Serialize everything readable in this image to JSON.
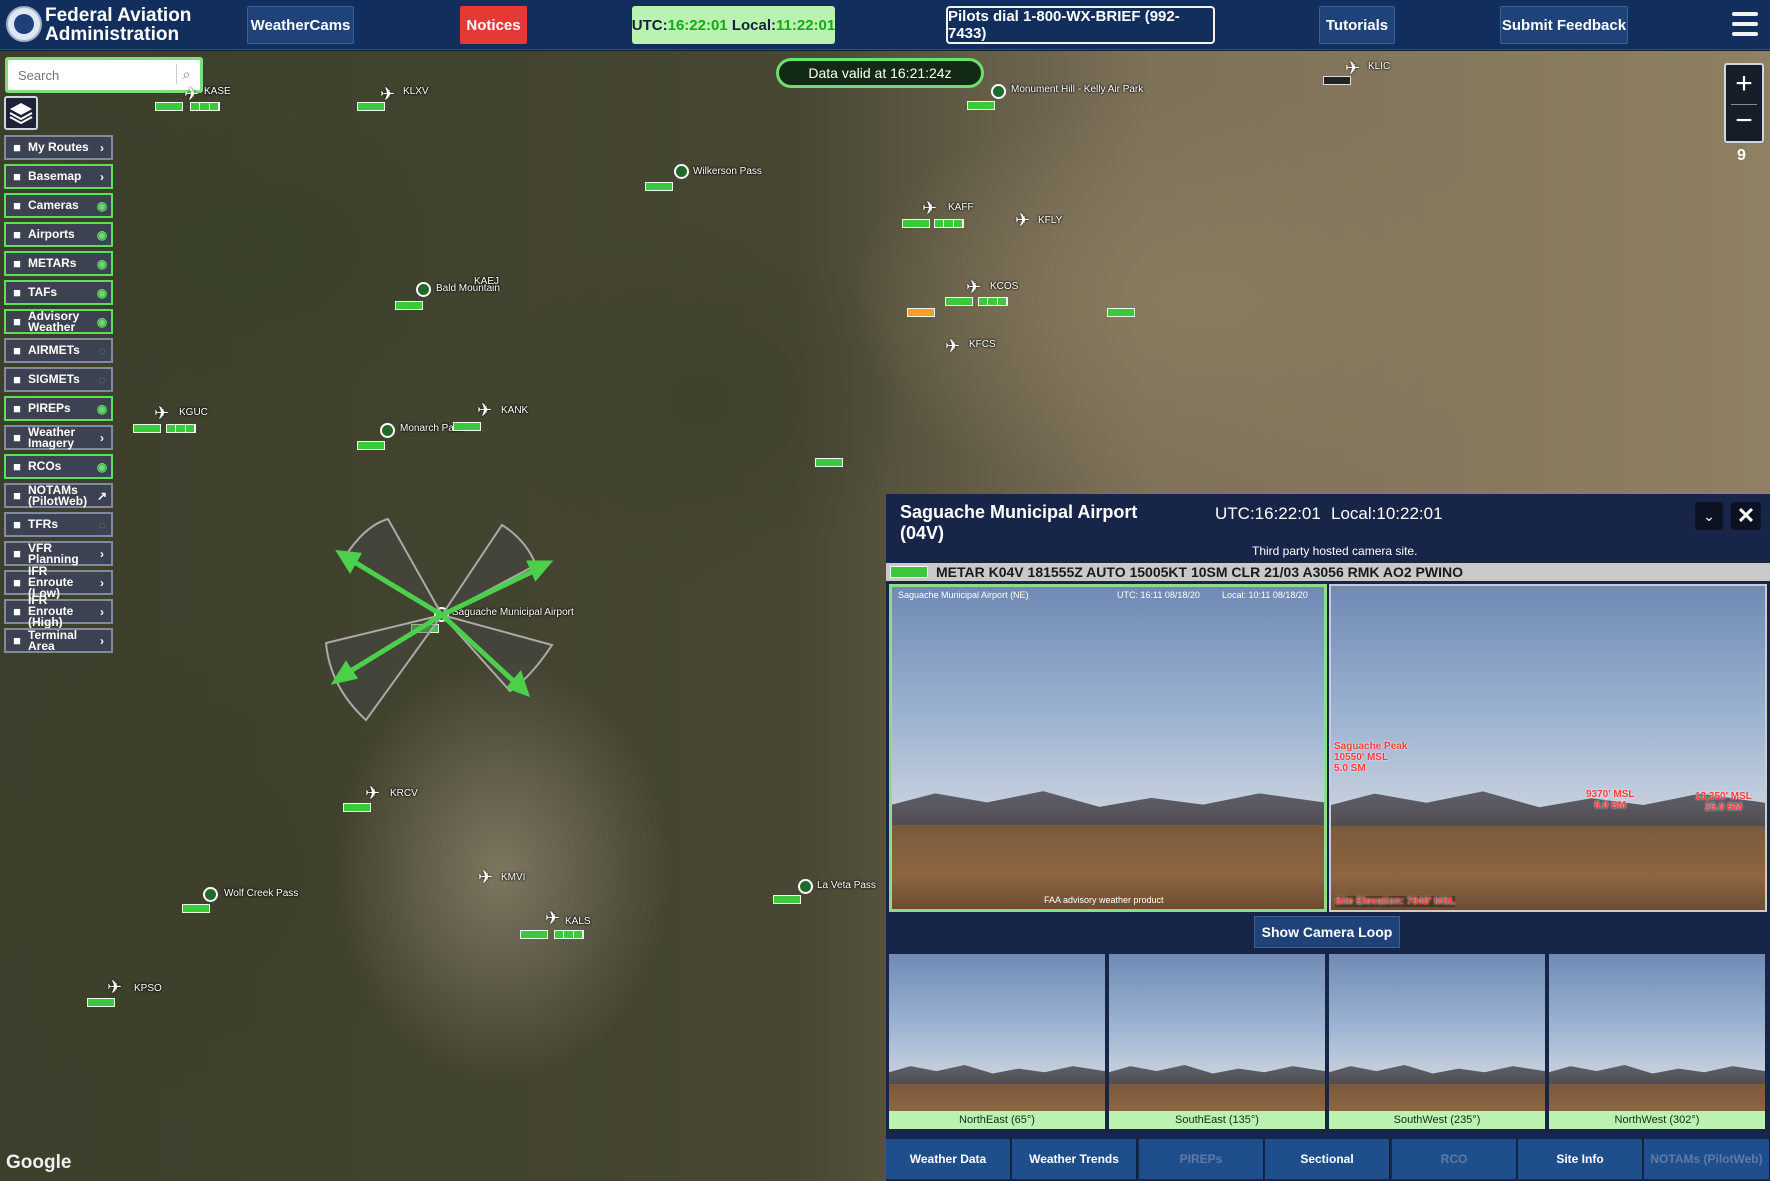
{
  "header": {
    "brand_line1": "Federal Aviation",
    "brand_line2": "Administration",
    "weathercams": "WeatherCams",
    "notices": "Notices",
    "utc_label": "UTC:",
    "utc_time": "16:22:01",
    "local_label": "Local:",
    "local_time": "11:22:01",
    "phone": "Pilots dial 1-800-WX-BRIEF (992-7433)",
    "tutorials": "Tutorials",
    "feedback": "Submit Feedback"
  },
  "search": {
    "placeholder": "Search"
  },
  "sidebar": {
    "items": [
      {
        "label": "My Routes",
        "icon": "route-icon",
        "trail": "›",
        "on": false
      },
      {
        "label": "Basemap",
        "icon": "globe-icon",
        "trail": "›",
        "on": true
      },
      {
        "label": "Cameras",
        "icon": "camera-circle-icon",
        "trail": "◉",
        "on": true
      },
      {
        "label": "Airports",
        "icon": "airplane-icon",
        "trail": "◉",
        "on": true
      },
      {
        "label": "METARs",
        "icon": "metar-bar-icon",
        "trail": "◉",
        "on": true
      },
      {
        "label": "TAFs",
        "icon": "taf-bar-icon",
        "trail": "◉",
        "on": true
      },
      {
        "label": "Advisory Weather",
        "icon": "advisory-icon",
        "trail": "◉",
        "on": true
      },
      {
        "label": "AIRMETs",
        "icon": "airmet-icon",
        "trail": "◌",
        "on": false
      },
      {
        "label": "SIGMETs",
        "icon": "sigmet-icon",
        "trail": "◌",
        "on": false
      },
      {
        "label": "PIREPs",
        "icon": "pirep-icon",
        "trail": "◉",
        "on": true
      },
      {
        "label": "Weather Imagery",
        "icon": "imagery-icon",
        "trail": "›",
        "on": false
      },
      {
        "label": "RCOs",
        "icon": "radio-icon",
        "trail": "◉",
        "on": true
      },
      {
        "label": "NOTAMs (PilotWeb)",
        "icon": "warning-icon",
        "trail": "↗",
        "on": false
      },
      {
        "label": "TFRs",
        "icon": "tfr-icon",
        "trail": "◌",
        "on": false
      },
      {
        "label": "VFR Planning",
        "icon": "vfr-icon",
        "trail": "›",
        "on": false
      },
      {
        "label": "IFR Enroute (Low)",
        "icon": "ifr-low-icon",
        "trail": "›",
        "on": false
      },
      {
        "label": "IFR Enroute (High)",
        "icon": "ifr-high-icon",
        "trail": "›",
        "on": false
      },
      {
        "label": "Terminal Area",
        "icon": "terminal-icon",
        "trail": "›",
        "on": false
      }
    ]
  },
  "map": {
    "valid_text": "Data valid at 16:21:24z",
    "zoom_level": "9",
    "attribution": "Google",
    "labels": [
      "KASE",
      "KLXV",
      "Monument Hill - Kelly Air Park",
      "KLIC",
      "Wilkerson Pass",
      "KAFF",
      "KFLY",
      "KCOS",
      "Bald Mountain",
      "KAEJ",
      "KFCS",
      "KGUC",
      "KANK",
      "Monarch Pass",
      "Saguache Municipal Airport",
      "KRCV",
      "KMVI",
      "La Veta Pass",
      "Wolf Creek Pass",
      "KALS",
      "KPSO"
    ]
  },
  "panel": {
    "title_line1": "Saguache Municipal Airport",
    "title_line2": "(04V)",
    "utc": "UTC:16:22:01",
    "local": "Local:10:22:01",
    "subtitle": "Third party hosted camera site.",
    "metar": "METAR K04V 181555Z AUTO 15005KT 10SM CLR 21/03 A3056 RMK AO2 PWINO",
    "main_image": {
      "caption": "Saguache Municipal Airport (NE)",
      "utc": "UTC: 16:11 08/18/20",
      "local": "Local: 10:11 08/18/20",
      "footer": "FAA advisory weather product"
    },
    "ref_image": {
      "peak": [
        "Saguache Peak",
        "10550' MSL",
        "5.0 SM"
      ],
      "mid": [
        "9370' MSL",
        "6.0 SM"
      ],
      "right": [
        "13,350' MSL",
        "25.0 SM"
      ],
      "elev": "Site Elevation: 7848' MSL"
    },
    "loop_button": "Show Camera Loop",
    "thumbs": [
      "NorthEast (65°)",
      "SouthEast (135°)",
      "SouthWest (235°)",
      "NorthWest (302°)"
    ],
    "tabs": [
      {
        "label": "Weather Data",
        "disabled": false
      },
      {
        "label": "Weather Trends",
        "disabled": false
      },
      {
        "label": "PIREPs",
        "disabled": true
      },
      {
        "label": "Sectional",
        "disabled": false
      },
      {
        "label": "RCO",
        "disabled": true
      },
      {
        "label": "Site Info",
        "disabled": false
      },
      {
        "label": "NOTAMs (PilotWeb)",
        "disabled": true
      }
    ]
  },
  "colors": {
    "header": "#112e5c",
    "accent_green": "#3cc83c",
    "notice_red": "#e53935",
    "clock_bg": "#b9f2b1",
    "metar_orange": "#ff9a2c"
  }
}
